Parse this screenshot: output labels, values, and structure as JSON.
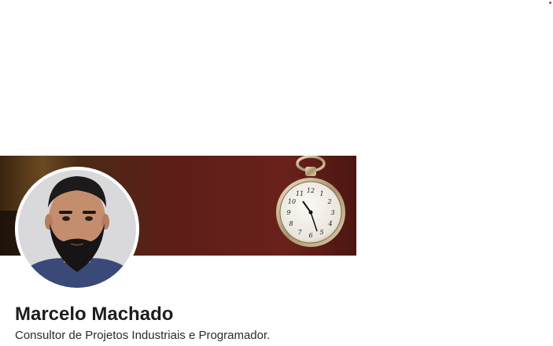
{
  "profile": {
    "name": "Marcelo Machado",
    "headline": "Consultor de Projetos Industriais e Programador."
  },
  "banner": {
    "image": "pocket-watch-photo",
    "background_color": "#5a1c17"
  },
  "avatar": {
    "image": "profile-photo-bearded-man"
  },
  "colors": {
    "accent_dot": "#c0392b",
    "name_text": "#1d1d1d"
  }
}
